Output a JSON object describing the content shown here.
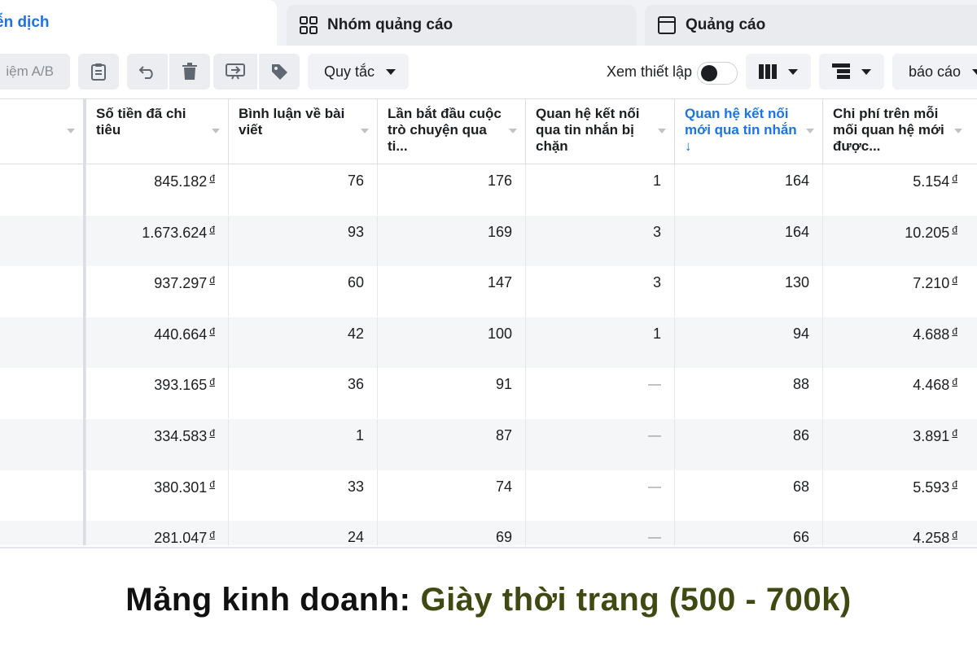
{
  "tabs": [
    {
      "label": "ễn dịch",
      "active": true
    },
    {
      "label": "Nhóm quảng cáo",
      "icon": "grid-icon"
    },
    {
      "label": "Quảng cáo",
      "icon": "ad-icon"
    }
  ],
  "toolbar": {
    "ab_test_label": "iệm A/B",
    "rules_label": "Quy tắc",
    "view_setting_label": "Xem thiết lập",
    "report_label": "báo cáo"
  },
  "table": {
    "headers": [
      {
        "label": "",
        "sorted": false
      },
      {
        "label": "Số tiền đã chi tiêu",
        "sorted": false
      },
      {
        "label": "Bình luận về bài viết",
        "sorted": false
      },
      {
        "label": "Lần bắt đầu cuộc trò chuyện qua ti...",
        "sorted": false
      },
      {
        "label": "Quan hệ kết nối qua tin nhắn bị chặn",
        "sorted": false
      },
      {
        "label": "Quan hệ kết nối mới qua tin nhắn ↓",
        "sorted": true
      },
      {
        "label": "Chi phí trên mỗi mối quan hệ mới được...",
        "sorted": false
      }
    ],
    "currency_symbol": "đ",
    "rows": [
      {
        "spend": "845.182",
        "comments": "76",
        "conversations": "176",
        "blocked": "1",
        "new_connections": "164",
        "cost_per": "5.154"
      },
      {
        "spend": "1.673.624",
        "comments": "93",
        "conversations": "169",
        "blocked": "3",
        "new_connections": "164",
        "cost_per": "10.205"
      },
      {
        "spend": "937.297",
        "comments": "60",
        "conversations": "147",
        "blocked": "3",
        "new_connections": "130",
        "cost_per": "7.210"
      },
      {
        "spend": "440.664",
        "comments": "42",
        "conversations": "100",
        "blocked": "1",
        "new_connections": "94",
        "cost_per": "4.688"
      },
      {
        "spend": "393.165",
        "comments": "36",
        "conversations": "91",
        "blocked": "—",
        "new_connections": "88",
        "cost_per": "4.468"
      },
      {
        "spend": "334.583",
        "comments": "1",
        "conversations": "87",
        "blocked": "—",
        "new_connections": "86",
        "cost_per": "3.891"
      },
      {
        "spend": "380.301",
        "comments": "33",
        "conversations": "74",
        "blocked": "—",
        "new_connections": "68",
        "cost_per": "5.593"
      },
      {
        "spend": "281.047",
        "comments": "24",
        "conversations": "69",
        "blocked": "—",
        "new_connections": "66",
        "cost_per": "4.258"
      }
    ]
  },
  "caption": {
    "label": "Mảng kinh doanh:",
    "value": "Giày thời trang (500 - 700k)"
  },
  "colors": {
    "accent": "#1b74e4",
    "caption_value": "#3e4a12"
  }
}
